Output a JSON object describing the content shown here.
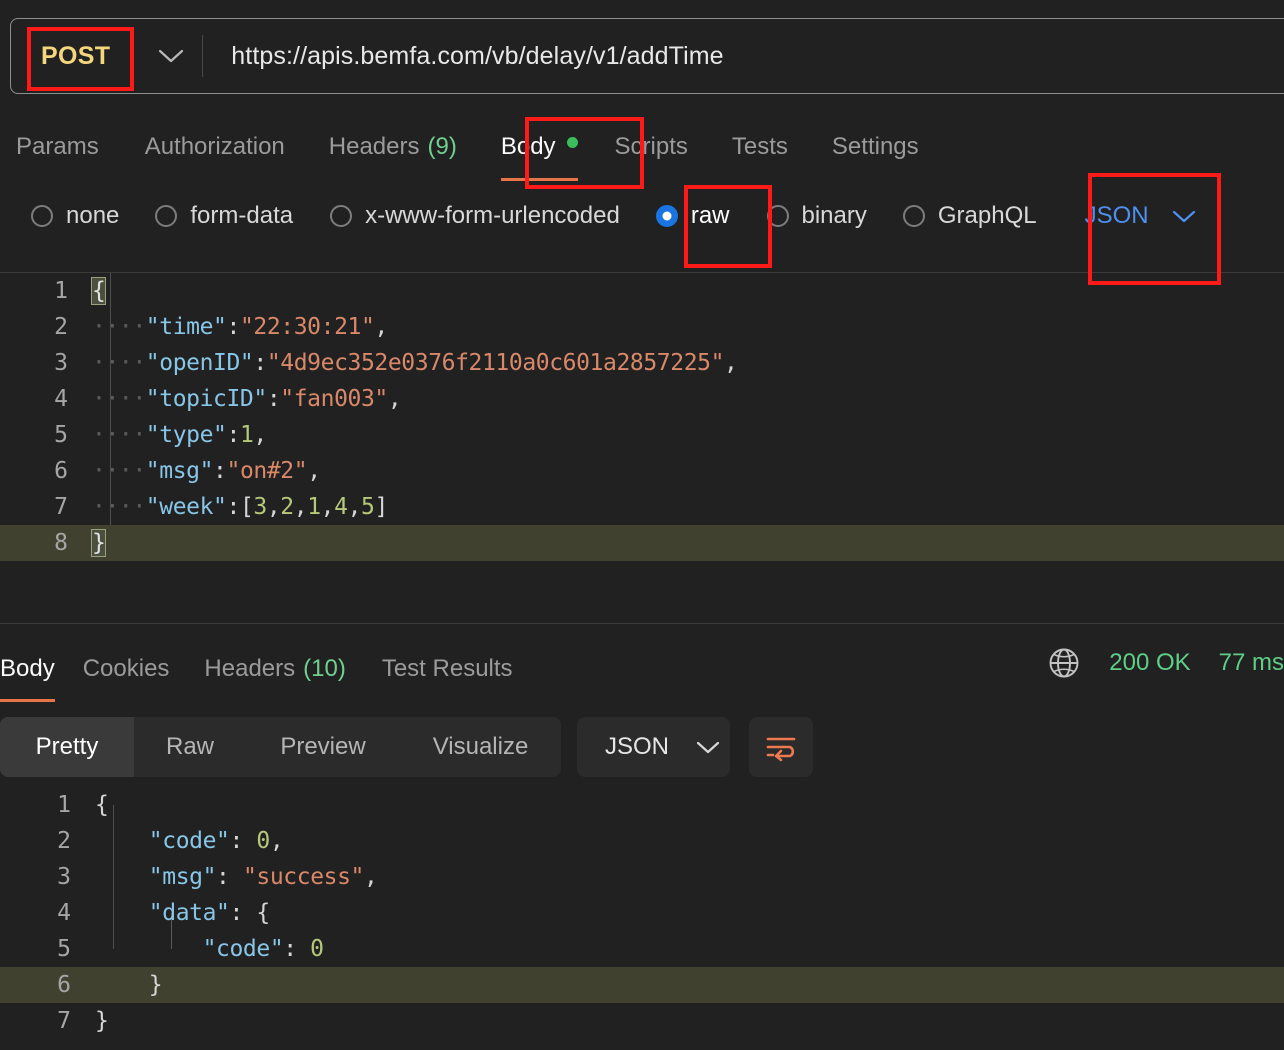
{
  "request": {
    "method": "POST",
    "method_chevron_icon": "chevron-down-icon",
    "url": "https://apis.bemfa.com/vb/delay/v1/addTime",
    "tabs": [
      {
        "label": "Params",
        "count": "",
        "active": false
      },
      {
        "label": "Authorization",
        "count": "",
        "active": false
      },
      {
        "label": "Headers",
        "count": "(9)",
        "active": false
      },
      {
        "label": "Body",
        "count": "",
        "active": true,
        "has_dot": true
      },
      {
        "label": "Scripts",
        "count": "",
        "active": false
      },
      {
        "label": "Tests",
        "count": "",
        "active": false
      },
      {
        "label": "Settings",
        "count": "",
        "active": false
      }
    ],
    "body_modes": [
      {
        "label": "none",
        "selected": false
      },
      {
        "label": "form-data",
        "selected": false
      },
      {
        "label": "x-www-form-urlencoded",
        "selected": false
      },
      {
        "label": "raw",
        "selected": true
      },
      {
        "label": "binary",
        "selected": false
      },
      {
        "label": "GraphQL",
        "selected": false
      }
    ],
    "body_format": "JSON",
    "body_format_chevron_icon": "chevron-down-icon",
    "body_lines": [
      {
        "num": "1",
        "active": false
      },
      {
        "num": "2",
        "active": false
      },
      {
        "num": "3",
        "active": false
      },
      {
        "num": "4",
        "active": false
      },
      {
        "num": "5",
        "active": false
      },
      {
        "num": "6",
        "active": false
      },
      {
        "num": "7",
        "active": false
      },
      {
        "num": "8",
        "active": true
      }
    ],
    "body_json": {
      "time": "22:30:21",
      "openID": "4d9ec352e0376f2110a0c601a2857225",
      "topicID": "fan003",
      "type": 1,
      "msg": "on#2",
      "week": [
        3,
        2,
        1,
        4,
        5
      ]
    },
    "body_raw_text": "{\n    \"time\":\"22:30:21\",\n    \"openID\":\"4d9ec352e0376f2110a0c601a2857225\",\n    \"topicID\":\"fan003\",\n    \"type\":1,\n    \"msg\":\"on#2\",\n    \"week\":[3,2,1,4,5]\n}"
  },
  "response": {
    "tabs": [
      {
        "label": "Body",
        "count": "",
        "active": true
      },
      {
        "label": "Cookies",
        "count": "",
        "active": false
      },
      {
        "label": "Headers",
        "count": "(10)",
        "active": false
      },
      {
        "label": "Test Results",
        "count": "",
        "active": false
      }
    ],
    "globe_icon": "globe-icon",
    "status": "200 OK",
    "time": "77 ms",
    "view_modes": [
      {
        "label": "Pretty",
        "active": true
      },
      {
        "label": "Raw",
        "active": false
      },
      {
        "label": "Preview",
        "active": false
      },
      {
        "label": "Visualize",
        "active": false
      }
    ],
    "format": "JSON",
    "format_chevron_icon": "chevron-down-icon",
    "wrap_icon": "word-wrap-icon",
    "body_lines": [
      {
        "num": "1",
        "active": false
      },
      {
        "num": "2",
        "active": false
      },
      {
        "num": "3",
        "active": false
      },
      {
        "num": "4",
        "active": false
      },
      {
        "num": "5",
        "active": false
      },
      {
        "num": "6",
        "active": true
      },
      {
        "num": "7",
        "active": false
      }
    ],
    "body_json": {
      "code": 0,
      "msg": "success",
      "data": {
        "code": 0
      }
    },
    "body_raw_text": "{\n    \"code\": 0,\n    \"msg\": \"success\",\n    \"data\": {\n        \"code\": 0\n    }\n}"
  },
  "annotations": [
    {
      "name": "post-method-highlight",
      "target": "POST"
    },
    {
      "name": "body-tab-highlight",
      "target": "Body"
    },
    {
      "name": "raw-radio-highlight",
      "target": "raw"
    },
    {
      "name": "json-format-highlight",
      "target": "JSON"
    }
  ],
  "colors": {
    "background": "#212121",
    "annotation_red": "#ff1a1a",
    "method_post": "#f4d67c",
    "accent_orange": "#e8744a",
    "status_green": "#5ecf86",
    "radio_blue": "#1a74e2",
    "json_blue": "#4f8ff0",
    "active_line": "#41412f",
    "json_key": "#88c6e8",
    "json_string": "#d9896a",
    "json_number": "#b6c97a"
  }
}
